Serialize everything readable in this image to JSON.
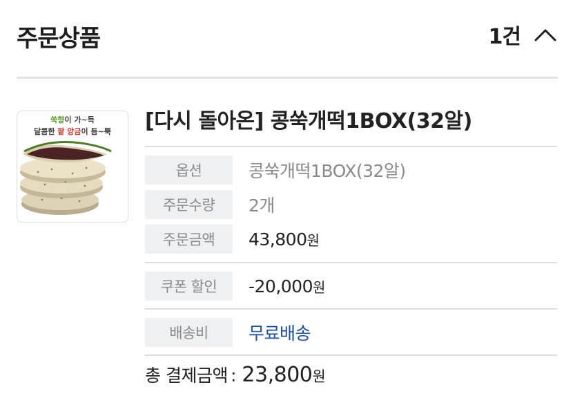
{
  "section": {
    "title": "주문상품",
    "count": "1건",
    "collapse_icon": "chevron-up-icon"
  },
  "product": {
    "name": "[다시 돌아온] 콩쑥개떡1BOX(32알)",
    "thumbnail": {
      "line1_green": "쑥향",
      "line1_rest": "이 가~득",
      "line2_start": "달콤한 ",
      "line2_red": "팥 앙금",
      "line2_end": "이 듬~뿍"
    }
  },
  "details": {
    "option_label": "옵션",
    "option_value": "콩쑥개떡1BOX(32알)",
    "quantity_label": "주문수량",
    "quantity_value": "2개",
    "amount_label": "주문금액",
    "amount_value": "43,800",
    "coupon_label": "쿠폰 할인",
    "coupon_value": "-20,000",
    "shipping_label": "배송비",
    "shipping_value": "무료배송",
    "currency_unit": "원"
  },
  "total": {
    "label": "총 결제금액",
    "separator": ":",
    "amount": "23,800",
    "unit": "원"
  },
  "colors": {
    "accent_blue": "#1f4e9d",
    "label_bg": "#eef0f2",
    "text_grey": "#8a8a8a"
  }
}
